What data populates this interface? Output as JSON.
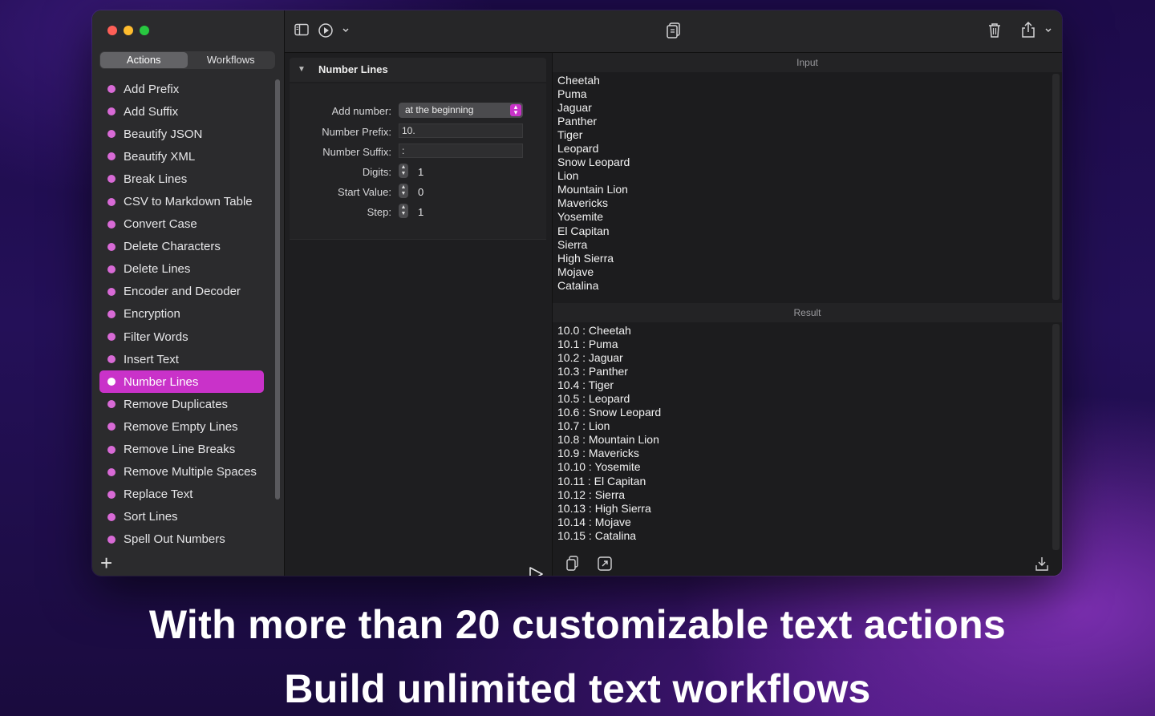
{
  "sidebar": {
    "tabs": [
      {
        "label": "Actions",
        "active": true
      },
      {
        "label": "Workflows",
        "active": false
      }
    ],
    "items": [
      {
        "label": "Add Prefix"
      },
      {
        "label": "Add Suffix"
      },
      {
        "label": "Beautify JSON"
      },
      {
        "label": "Beautify XML"
      },
      {
        "label": "Break Lines"
      },
      {
        "label": "CSV to Markdown Table"
      },
      {
        "label": "Convert Case"
      },
      {
        "label": "Delete Characters"
      },
      {
        "label": "Delete Lines"
      },
      {
        "label": "Encoder and Decoder"
      },
      {
        "label": "Encryption"
      },
      {
        "label": "Filter Words"
      },
      {
        "label": "Insert Text"
      },
      {
        "label": "Number Lines",
        "selected": true
      },
      {
        "label": "Remove Duplicates"
      },
      {
        "label": "Remove Empty Lines"
      },
      {
        "label": "Remove Line Breaks"
      },
      {
        "label": "Remove Multiple Spaces"
      },
      {
        "label": "Replace Text"
      },
      {
        "label": "Sort Lines"
      },
      {
        "label": "Spell Out Numbers"
      }
    ],
    "add_label": "+"
  },
  "settings": {
    "title": "Number Lines",
    "add_number": {
      "label": "Add number:",
      "value": "at the beginning"
    },
    "number_prefix": {
      "label": "Number Prefix:",
      "value": "10."
    },
    "number_suffix": {
      "label": "Number Suffix:",
      "value": ":"
    },
    "digits": {
      "label": "Digits:",
      "value": "1"
    },
    "start_value": {
      "label": "Start Value:",
      "value": "0"
    },
    "step": {
      "label": "Step:",
      "value": "1"
    }
  },
  "input": {
    "title": "Input",
    "text": "Cheetah\nPuma\nJaguar\nPanther\nTiger\nLeopard\nSnow Leopard\nLion\nMountain Lion\nMavericks\nYosemite\nEl Capitan\nSierra\nHigh Sierra\nMojave\nCatalina"
  },
  "result": {
    "title": "Result",
    "text": "10.0 : Cheetah\n10.1 : Puma\n10.2 : Jaguar\n10.3 : Panther\n10.4 : Tiger\n10.5 : Leopard\n10.6 : Snow Leopard\n10.7 : Lion\n10.8 : Mountain Lion\n10.9 : Mavericks\n10.10 : Yosemite\n10.11 : El Capitan\n10.12 : Sierra\n10.13 : High Sierra\n10.14 : Mojave\n10.15 : Catalina"
  },
  "icons": {
    "sidebar_toggle": "sidebar-toggle-icon",
    "run_menu": "run-menu-icon",
    "copy": "copy-icon",
    "trash": "trash-icon",
    "share": "share-icon",
    "run": "play-icon",
    "paste": "clipboard-icon",
    "swap": "swap-icon",
    "export": "export-icon"
  },
  "colors": {
    "accent": "#c932c9",
    "dot": "#d86ad6"
  },
  "captions": {
    "line1": "With more than 20 customizable text actions",
    "line2": "Build unlimited text workflows"
  }
}
